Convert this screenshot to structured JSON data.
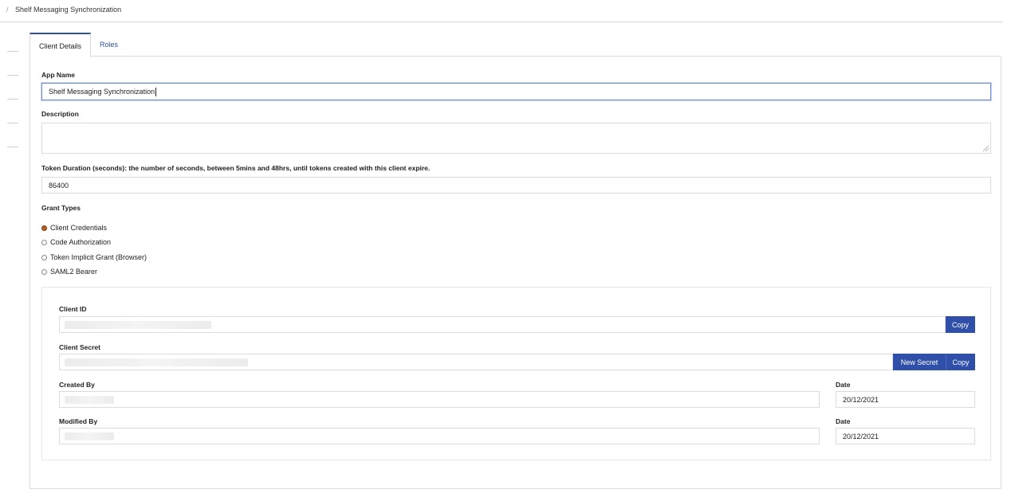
{
  "breadcrumb": {
    "separator": "/",
    "current": "Shelf Messaging Synchronization"
  },
  "tabs": [
    {
      "label": "Client Details",
      "active": true
    },
    {
      "label": "Roles",
      "active": false
    }
  ],
  "form": {
    "app_name": {
      "label": "App Name",
      "value": "Shelf Messaging Synchronization"
    },
    "description": {
      "label": "Description",
      "value": ""
    },
    "token_duration": {
      "label": "Token Duration (seconds): the number of seconds, between 5mins and 48hrs, until tokens created with this client expire.",
      "value": "86400"
    },
    "grant_types": {
      "label": "Grant Types",
      "options": [
        {
          "label": "Client Credentials",
          "checked": true
        },
        {
          "label": "Code Authorization",
          "checked": false
        },
        {
          "label": "Token Implicit Grant (Browser)",
          "checked": false
        },
        {
          "label": "SAML2 Bearer",
          "checked": false
        }
      ]
    }
  },
  "credentials": {
    "client_id": {
      "label": "Client ID",
      "copy_label": "Copy"
    },
    "client_secret": {
      "label": "Client Secret",
      "new_secret_label": "New Secret",
      "copy_label": "Copy"
    },
    "created_by": {
      "label": "Created By",
      "date_label": "Date",
      "date_value": "20/12/2021"
    },
    "modified_by": {
      "label": "Modified By",
      "date_label": "Date",
      "date_value": "20/12/2021"
    }
  },
  "colors": {
    "accent": "#2f4fa8",
    "radio_checked": "#b0622a",
    "border": "#dcdcdc"
  }
}
